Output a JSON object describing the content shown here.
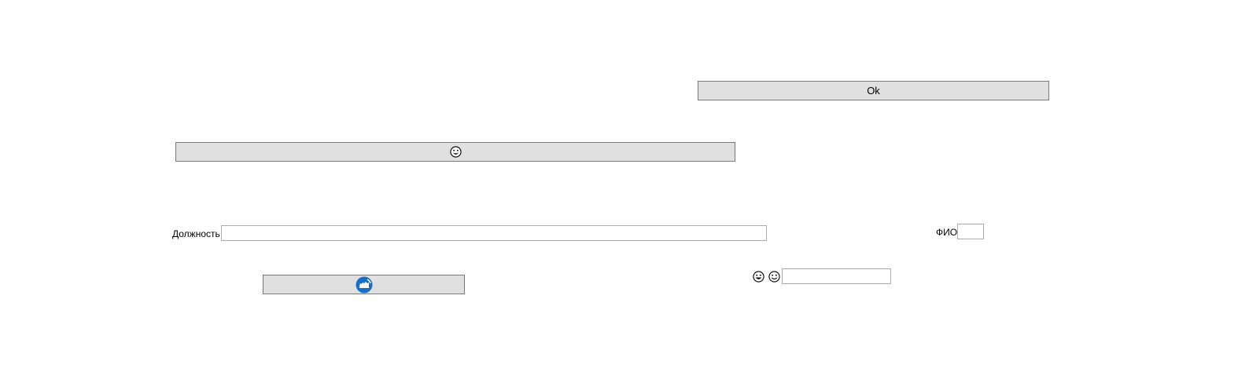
{
  "ok_button": {
    "label": "Ok"
  },
  "emoji_button": {
    "icon": "grinning-face-icon"
  },
  "position_field": {
    "label": "Должность",
    "value": ""
  },
  "fio_field": {
    "label": "ФИО",
    "value": ""
  },
  "image_button": {
    "icon": "blue-circle-logo-icon",
    "color": "#1a6fc4"
  },
  "emoji_input": {
    "icons": [
      "grinning-face-icon",
      "smiling-face-icon"
    ],
    "value": ""
  }
}
